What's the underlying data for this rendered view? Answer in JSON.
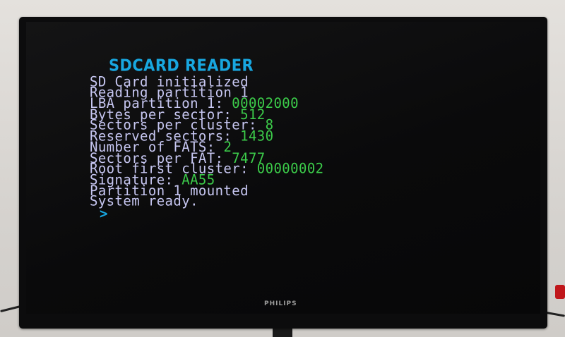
{
  "title": "SDCARD READER",
  "lines": [
    {
      "label": "SD Card initialized",
      "value": ""
    },
    {
      "label": "Reading partition 1",
      "value": ""
    },
    {
      "label": "LBA partition 1: ",
      "value": "00002000"
    },
    {
      "label": "Bytes per sector: ",
      "value": "512"
    },
    {
      "label": "Sectors per cluster: ",
      "value": "8"
    },
    {
      "label": "Reserved sectors: ",
      "value": "1430"
    },
    {
      "label": "Number of FATS: ",
      "value": "2"
    },
    {
      "label": "Sectors per FAT: ",
      "value": "7477"
    },
    {
      "label": "Root first cluster: ",
      "value": "00000002"
    },
    {
      "label": "Signature: ",
      "value": "AA55"
    },
    {
      "label": "Partition 1 mounted",
      "value": ""
    },
    {
      "label": "System ready.",
      "value": ""
    }
  ],
  "prompt": ">",
  "monitor_brand": "PHILIPS",
  "colors": {
    "title": "#18a7e0",
    "text": "#c7c7f2",
    "value": "#3ccc4a",
    "prompt": "#18a7e0",
    "screen_background": "#0a0a0b"
  }
}
